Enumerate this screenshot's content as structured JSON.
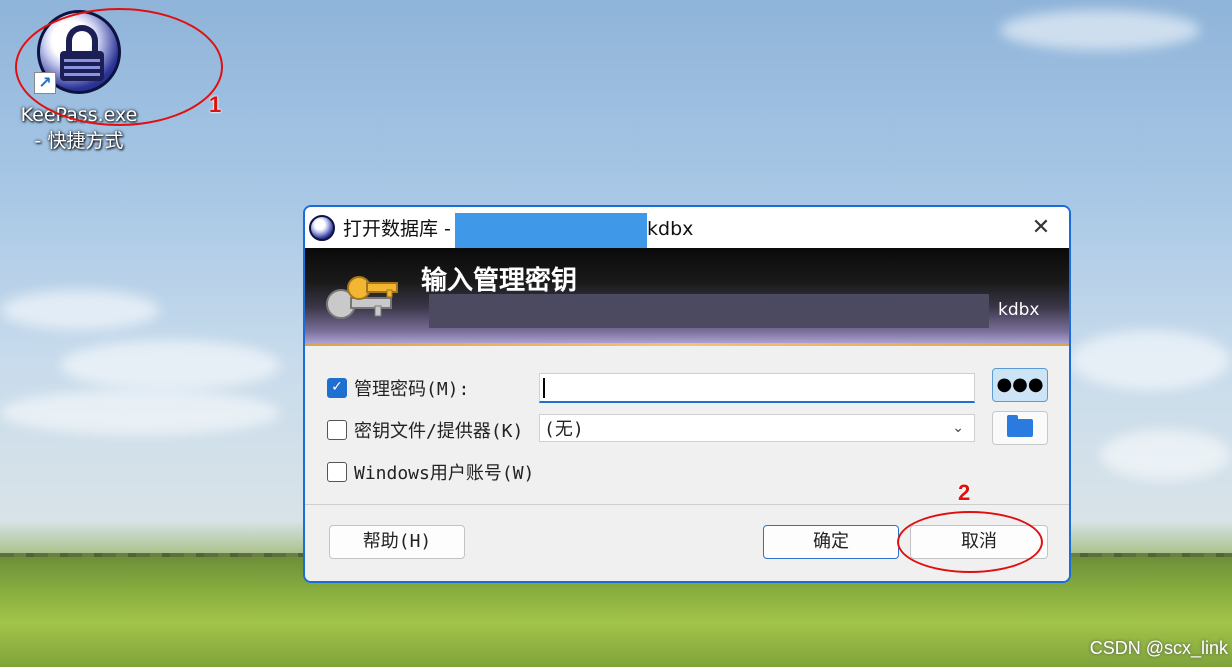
{
  "desktop": {
    "shortcut_label_line1": "KeePass.exe",
    "shortcut_label_line2": "- 快捷方式"
  },
  "annotations": {
    "step1": "1",
    "step2": "2",
    "color": "#e01010"
  },
  "dialog": {
    "title_prefix": "打开数据库 -",
    "title_suffix": "kdbx",
    "close_glyph": "✕",
    "banner_title": "输入管理密钥",
    "banner_suffix": "kdbx",
    "master_password": {
      "label": "管理密码(M):",
      "checked": true,
      "value": ""
    },
    "reveal_button_glyph": "●●●",
    "key_file": {
      "label": "密钥文件/提供器(K)",
      "checked": false,
      "selected": "(无)"
    },
    "windows_account": {
      "label": "Windows用户账号(W)",
      "checked": false
    },
    "buttons": {
      "help": "帮助(H)",
      "ok": "确定",
      "cancel": "取消"
    },
    "accent": "#1f6fd1"
  },
  "watermark": "CSDN @scx_link"
}
